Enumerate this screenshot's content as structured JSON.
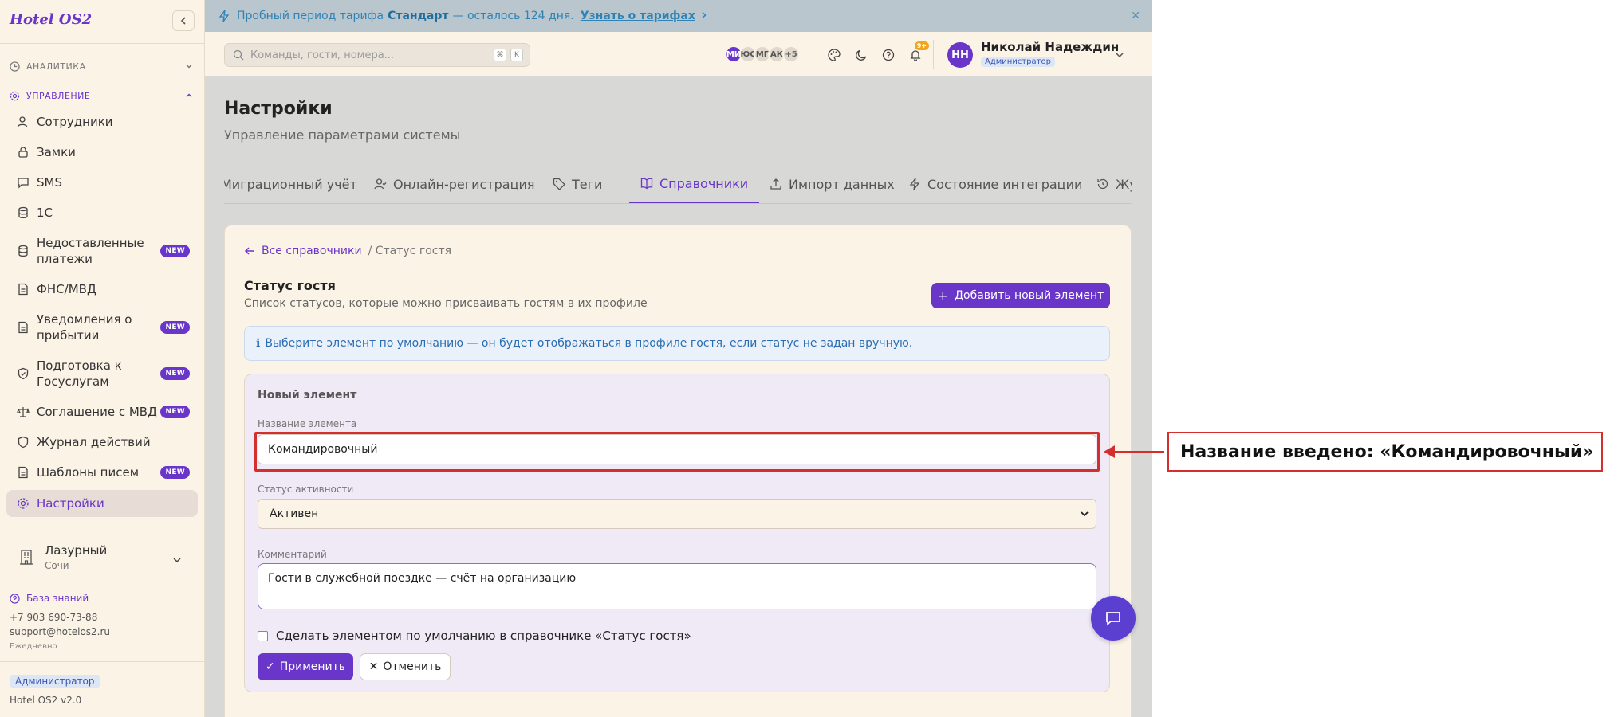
{
  "sidebar": {
    "logo": "Hotel OS2",
    "sections": {
      "analytics": "АНАЛИТИКА",
      "management": "УПРАВЛЕНИЕ"
    },
    "items": [
      {
        "label": "Сотрудники"
      },
      {
        "label": "Замки"
      },
      {
        "label": "SMS"
      },
      {
        "label": "1С"
      },
      {
        "label": "Недоставленные платежи",
        "badge": "NEW"
      },
      {
        "label": "ФНС/МВД"
      },
      {
        "label": "Уведомления о прибытии",
        "badge": "NEW"
      },
      {
        "label": "Подготовка к Госуслугам",
        "badge": "NEW"
      },
      {
        "label": "Соглашение с МВД",
        "badge": "NEW"
      },
      {
        "label": "Журнал действий"
      },
      {
        "label": "Шаблоны писем",
        "badge": "NEW"
      },
      {
        "label": "Настройки"
      }
    ],
    "hotel": {
      "name": "Лазурный",
      "city": "Сочи"
    },
    "footer": {
      "kb": "База знаний",
      "phone": "+7 903 690-73-88",
      "email": "support@hotelos2.ru",
      "schedule": "Ежедневно",
      "role": "Администратор",
      "version": "Hotel OS2 v2.0"
    }
  },
  "banner": {
    "prefix": "Пробный период тарифа",
    "plan": "Стандарт",
    "suffix": "— осталось 124 дня.",
    "link": "Узнать о тарифах"
  },
  "topbar": {
    "search_placeholder": "Команды, гости, номера...",
    "kbd": [
      "⌘",
      "K"
    ],
    "avatars": [
      "МИ",
      "ЮС",
      "МГ",
      "АК",
      "+5"
    ],
    "notif_count": "9+",
    "user": {
      "initials": "НН",
      "name": "Николай Надеждин",
      "role": "Администратор"
    }
  },
  "page": {
    "title": "Настройки",
    "subtitle": "Управление параметрами системы"
  },
  "tabs": [
    {
      "label": "Миграционный учёт"
    },
    {
      "label": "Онлайн-регистрация"
    },
    {
      "label": "Теги"
    },
    {
      "label": "Справочники"
    },
    {
      "label": "Импорт данных"
    },
    {
      "label": "Состояние интеграции"
    },
    {
      "label": "Журнал"
    }
  ],
  "card": {
    "crumb_back": "Все справочники",
    "crumb_current": "/ Статус гостя",
    "title": "Статус гостя",
    "subtitle": "Список статусов, которые можно присваивать гостям в их профиле",
    "add_button": "Добавить новый элемент",
    "info": "Выберите элемент по умолчанию — он будет отображаться в профиле гостя, если статус не задан вручную."
  },
  "form": {
    "title": "Новый элемент",
    "name_label": "Название элемента",
    "name_value": "Командировочный",
    "status_label": "Статус активности",
    "status_value": "Активен",
    "comment_label": "Комментарий",
    "comment_value": "Гости в служебной поездке — счёт на организацию",
    "default_check": "Сделать элементом по умолчанию в справочнике «Статус гостя»",
    "apply": "Применить",
    "cancel": "Отменить"
  },
  "annotation": {
    "text": "Название введено: «Командировочный»"
  },
  "colors": {
    "accent": "#6a35c9",
    "highlight": "#d32f2f"
  }
}
